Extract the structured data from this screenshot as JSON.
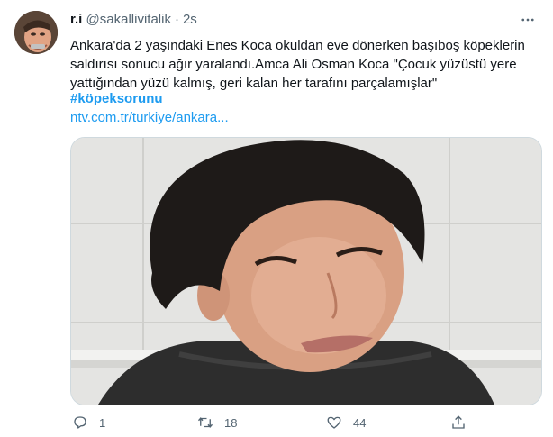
{
  "tweet": {
    "display_name": "r.i",
    "handle": "@sakallivitalik",
    "separator": "·",
    "time": "2s",
    "text": "Ankara'da 2 yaşındaki Enes Koca okuldan eve dönerken başıboş köpeklerin saldırısı sonucu ağır yaralandı.Amca Ali Osman Koca \"Çocuk yüzüstü yere yattığından yüzü kalmış, geri kalan her tarafını parçalamışlar\"",
    "hashtag": "#köpeksorunu",
    "link": "ntv.com.tr/turkiye/ankara..."
  },
  "actions": {
    "reply_count": "1",
    "retweet_count": "18",
    "like_count": "44"
  },
  "icons": {
    "more": "more-icon",
    "reply": "reply-icon",
    "retweet": "retweet-icon",
    "like": "heart-icon",
    "share": "share-icon"
  },
  "colors": {
    "link": "#1d9bf0",
    "secondary_text": "#536471",
    "primary_text": "#0f1419"
  }
}
